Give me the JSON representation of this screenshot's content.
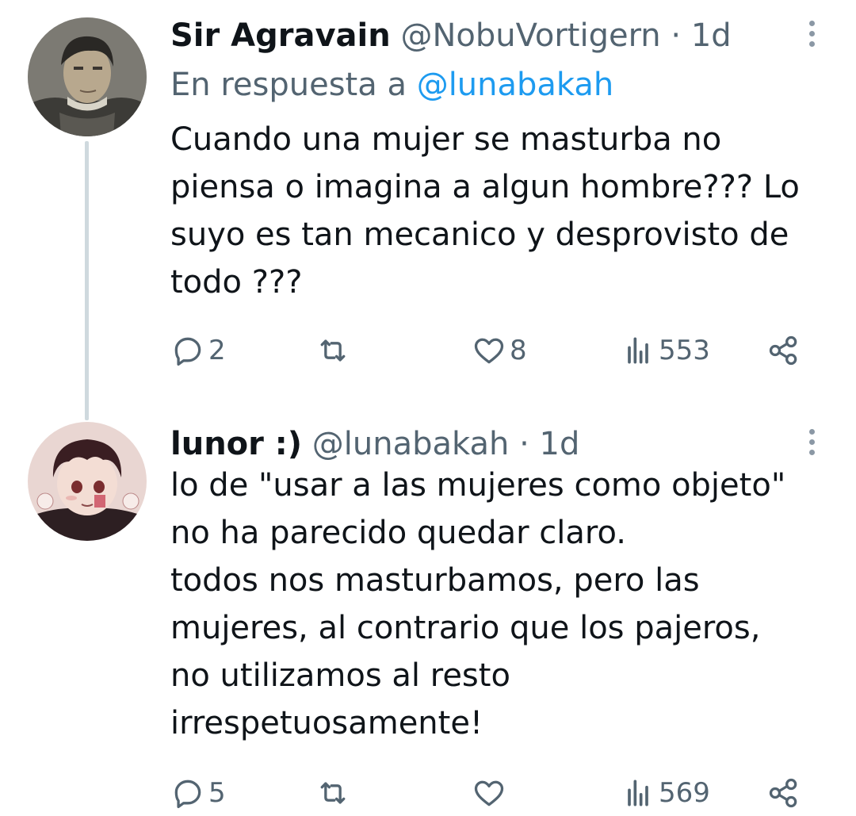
{
  "tweets": [
    {
      "name": "Sir Agravain",
      "handle": "@NobuVortigern",
      "separator": "·",
      "time": "1d",
      "reply_prefix": "En respuesta a",
      "reply_handle": "@lunabakah",
      "text": "Cuando una mujer se masturba no\npiensa o imagina a algun hombre??? Lo\nsuyo es tan mecanico y desprovisto de\ntodo ???",
      "replies": "2",
      "likes": "8",
      "views": "553"
    },
    {
      "name": "lunor :)",
      "handle": "@lunabakah",
      "separator": "·",
      "time": "1d",
      "text": "lo de \"usar a las mujeres como objeto\"\nno ha parecido quedar claro.\ntodos nos masturbamos, pero las\nmujeres, al contrario que los pajeros,\nno utilizamos al resto\nirrespetuosamente!",
      "replies": "5",
      "views": "569"
    }
  ],
  "colors": {
    "text": "#0f1419",
    "secondary": "#536471",
    "link": "#1d9bf0",
    "thread_line": "#cfd9de"
  },
  "icons": [
    "reply-icon",
    "retweet-icon",
    "like-icon",
    "views-icon",
    "share-icon",
    "more-options-icon"
  ]
}
